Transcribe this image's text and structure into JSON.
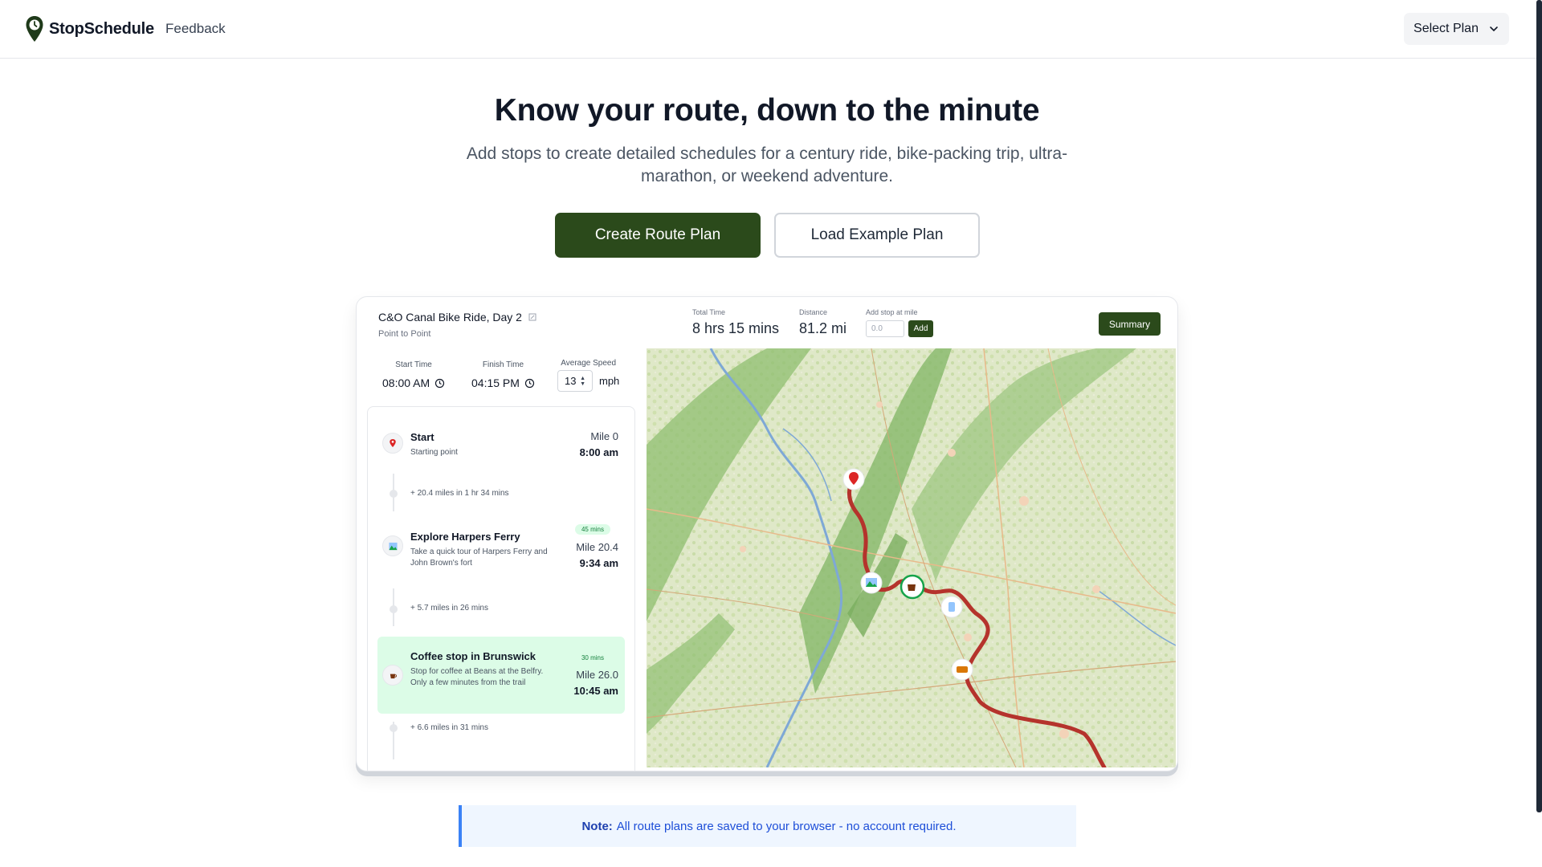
{
  "header": {
    "logo_text": "StopSchedule",
    "nav_feedback": "Feedback",
    "select_plan": "Select Plan"
  },
  "hero": {
    "title": "Know your route, down to the minute",
    "subtitle": "Add stops to create detailed schedules for a century ride, bike-packing trip, ultra-marathon, or weekend adventure.",
    "primary_button": "Create Route Plan",
    "secondary_button": "Load Example Plan"
  },
  "preview": {
    "title": "C&O Canal Bike Ride, Day 2",
    "subtitle": "Point to Point",
    "total_time_label": "Total Time",
    "total_time": "8 hrs 15 mins",
    "distance_label": "Distance",
    "distance": "81.2 mi",
    "add_stop_label": "Add stop at mile",
    "add_stop_placeholder": "0.0",
    "add_button": "Add",
    "summary_button": "Summary",
    "start_time_label": "Start Time",
    "start_time": "08:00 AM",
    "finish_time_label": "Finish Time",
    "finish_time": "04:15 PM",
    "avg_speed_label": "Average Speed",
    "avg_speed": "13",
    "speed_unit": "mph",
    "stops": [
      {
        "name": "Start",
        "desc": "Starting point",
        "mile": "Mile 0",
        "time": "8:00 am",
        "icon": "pin-icon"
      },
      {
        "name": "Explore Harpers Ferry",
        "desc": "Take a quick tour of Harpers Ferry and John Brown's fort",
        "mile": "Mile 20.4",
        "time": "9:34 am",
        "duration": "45 mins",
        "icon": "landscape-icon"
      },
      {
        "name": "Coffee stop in Brunswick",
        "desc": "Stop for coffee at Beans at the Belfry. Only a few minutes from the trail",
        "mile": "Mile 26.0",
        "time": "10:45 am",
        "duration": "30 mins",
        "icon": "coffee-icon"
      }
    ],
    "segments": [
      "+ 20.4 miles in 1 hr 34 mins",
      "+ 5.7 miles in 26 mins",
      "+ 6.6 miles in 31 mins"
    ]
  },
  "note": {
    "label": "Note:",
    "text": "All route plans are saved to your browser - no account required."
  },
  "colors": {
    "brand_green": "#2b4a1b",
    "route_red": "#b5332c",
    "highlight_green": "#dcfce7",
    "note_blue": "#1d4ed8"
  }
}
